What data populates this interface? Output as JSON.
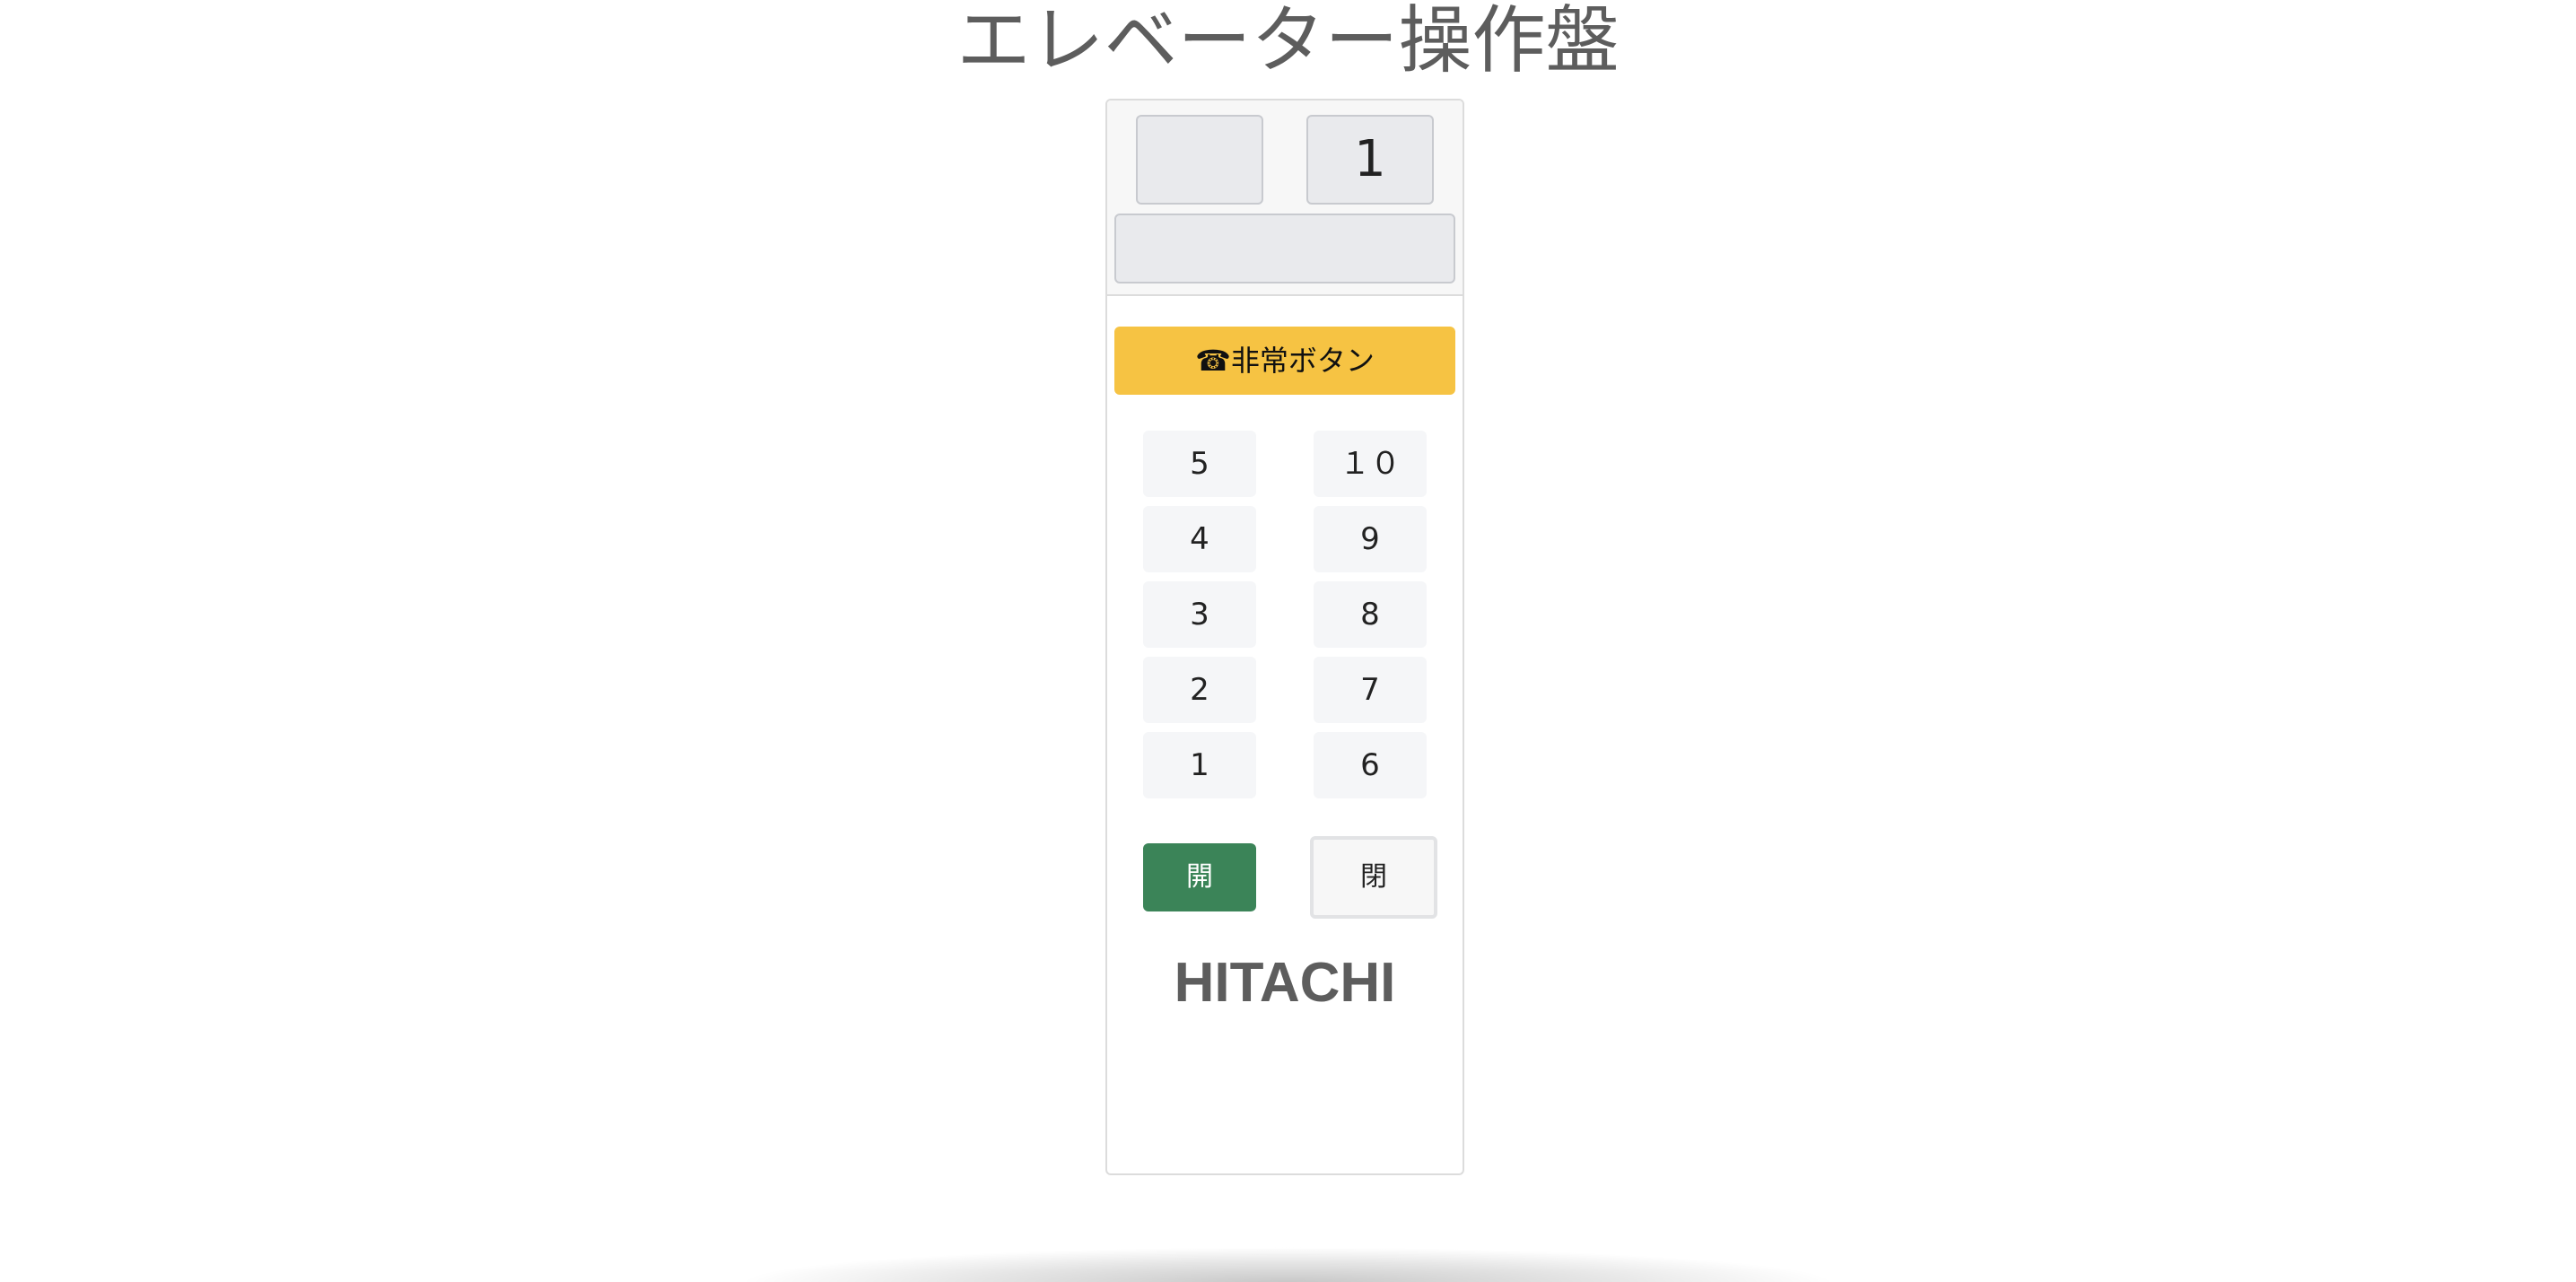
{
  "page": {
    "title": "エレベーター操作盤"
  },
  "panel": {
    "direction_display": "",
    "floor_display": "1",
    "message_display": "",
    "emergency_label": "☎非常ボタン",
    "floor_buttons_left": [
      "5",
      "4",
      "3",
      "2",
      "1"
    ],
    "floor_buttons_right": [
      "１０",
      "9",
      "8",
      "7",
      "6"
    ],
    "open_label": "開",
    "close_label": "閉",
    "brand": "HITACHI"
  },
  "colors": {
    "emergency": "#f6c343",
    "open_button": "#3b8458",
    "title_text": "#5d5d5d"
  }
}
